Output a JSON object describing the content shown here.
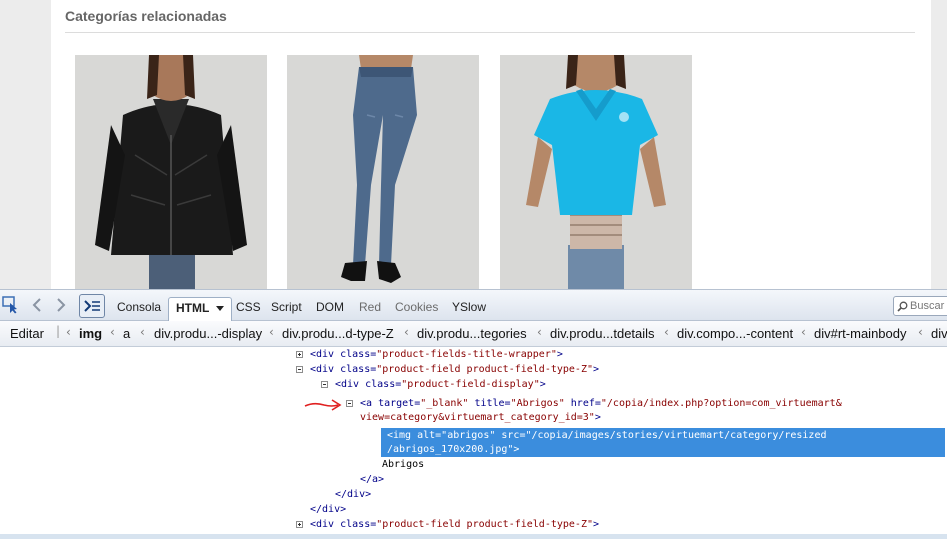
{
  "page": {
    "section_title": "Categorías relacionadas",
    "images": [
      {
        "name": "black-leather-jacket"
      },
      {
        "name": "blue-jeans"
      },
      {
        "name": "cyan-polo-shirt"
      }
    ]
  },
  "firebug": {
    "tabs": {
      "console": "Consola",
      "html": "HTML",
      "css": "CSS",
      "script": "Script",
      "dom": "DOM",
      "net": "Red",
      "cookies": "Cookies",
      "yslow": "YSlow"
    },
    "search_placeholder": "Buscar",
    "edit_label": "Editar",
    "breadcrumbs": [
      "img",
      "a",
      "div.produ...-display",
      "div.produ...d-type-Z",
      "div.produ...tegories",
      "div.produ...tdetails",
      "div.compo...-content",
      "div#rt-mainbody",
      "div"
    ],
    "tree": {
      "l1_tag": "<div",
      "l1_attr": "class=",
      "l1_val": "\"product-fields-title-wrapper\"",
      "l1_end": ">",
      "l2_tag": "<div",
      "l2_attr": "class=",
      "l2_val": "\"product-field product-field-type-Z\"",
      "l2_end": ">",
      "l3_tag": "<div",
      "l3_attr": "class=",
      "l3_val": "\"product-field-display\"",
      "l3_end": ">",
      "l4_tag": "<a",
      "l4_attr1": "target=",
      "l4_val1": "\"_blank\"",
      "l4_attr2": "title=",
      "l4_val2": "\"Abrigos\"",
      "l4_attr3": "href=",
      "l4_val3": "\"/copia/index.php?option=com_virtuemart&",
      "l4b_val": "view=category&virtuemart_category_id=3\"",
      "l4b_end": ">",
      "sel_line1": "<img alt=\"abrigos\" src=\"/copia/images/stories/virtuemart/category/resized",
      "sel_line2": "/abrigos_170x200.jpg\">",
      "text_node": "Abrigos",
      "close_a": "</a>",
      "close_div1": "</div>",
      "close_div2": "</div>",
      "l_last_tag": "<div",
      "l_last_attr": "class=",
      "l_last_val": "\"product-field product-field-type-Z\"",
      "l_last_end": ">"
    }
  },
  "colors": {
    "selection": "#3b8ddd",
    "tag": "#000088",
    "attr_value": "#880000",
    "arrow": "#e02020"
  }
}
